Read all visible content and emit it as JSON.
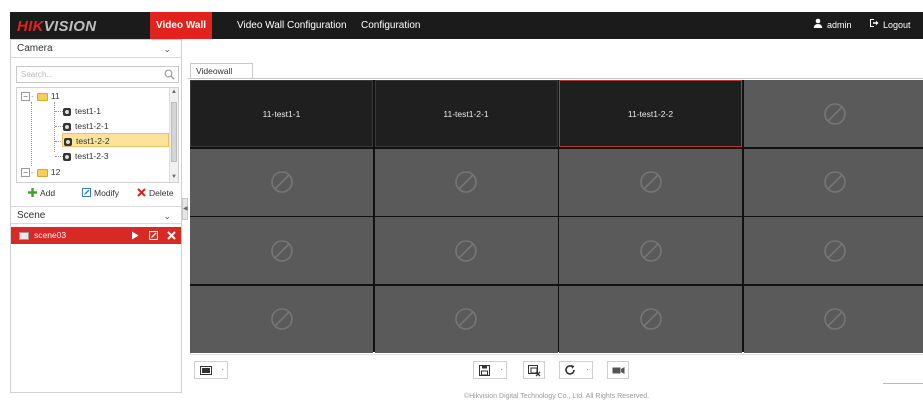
{
  "header": {
    "logo_hik": "HIK",
    "logo_vision": "VISION",
    "nav": [
      {
        "label": "Video Wall",
        "active": true
      },
      {
        "label": "Video Wall Configuration",
        "active": false
      },
      {
        "label": "Configuration",
        "active": false
      }
    ],
    "user": "admin",
    "logout": "Logout",
    "accent": "#e0231c"
  },
  "camera_panel": {
    "title": "Camera",
    "search_placeholder": "Search...",
    "tree": [
      {
        "label": "11",
        "type": "group",
        "expanded": true
      },
      {
        "label": "test1-1",
        "type": "camera"
      },
      {
        "label": "test1-2-1",
        "type": "camera"
      },
      {
        "label": "test1-2-2",
        "type": "camera",
        "selected": true
      },
      {
        "label": "test1-2-3",
        "type": "camera"
      },
      {
        "label": "12",
        "type": "group",
        "expanded": true
      }
    ],
    "actions": {
      "add": "Add",
      "modify": "Modify",
      "delete": "Delete"
    }
  },
  "scene_panel": {
    "title": "Scene",
    "scenes": [
      {
        "label": "scene03",
        "active": true
      }
    ]
  },
  "main": {
    "tab": "Videowall",
    "grid": {
      "rows": 4,
      "cols": 4
    },
    "cells": [
      {
        "label": "11-test1-1",
        "bound": true
      },
      {
        "label": "11-test1-2-1",
        "bound": true
      },
      {
        "label": "11-test1-2-2",
        "bound": true,
        "selected": true
      },
      {
        "label": "",
        "bound": false
      }
    ]
  },
  "footer": "©Hikvision Digital Technology Co., Ltd. All Rights Reserved."
}
